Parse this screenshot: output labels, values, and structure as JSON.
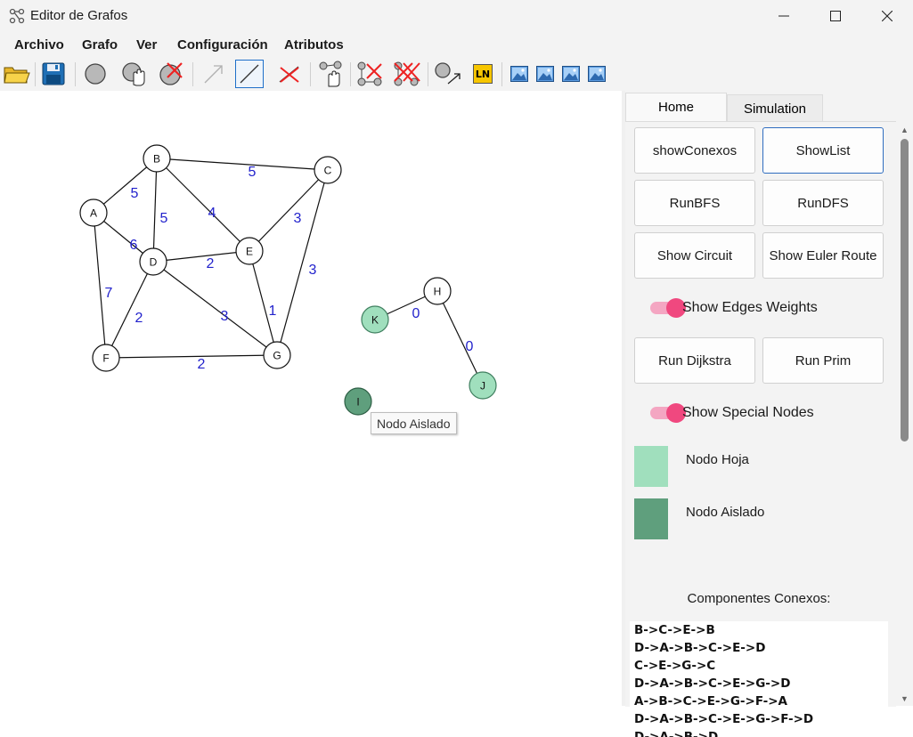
{
  "window": {
    "title": "Editor de Grafos",
    "minimize": "—",
    "maximize": "☐",
    "close": "✕"
  },
  "menu": [
    "Archivo",
    "Grafo",
    "Ver",
    "Configuración",
    "Atributos"
  ],
  "toolbar": {
    "tools": [
      "open-folder-icon",
      "save-icon",
      "add-node-icon",
      "move-node-icon",
      "delete-node-icon",
      "directed-edge-icon",
      "undirected-edge-icon",
      "delete-edge-icon",
      "move-graph-icon",
      "delete-graph-icon",
      "delete-all-icon",
      "node-arrow-icon",
      "ln-label-icon",
      "image-icon-1",
      "image-icon-2",
      "image-icon-3",
      "image-icon-4"
    ],
    "ln_label": "LN",
    "active_tool": "undirected-edge-icon"
  },
  "graph": {
    "nodes": [
      {
        "id": "A",
        "type": "normal"
      },
      {
        "id": "B",
        "type": "normal"
      },
      {
        "id": "C",
        "type": "normal"
      },
      {
        "id": "D",
        "type": "normal"
      },
      {
        "id": "E",
        "type": "normal"
      },
      {
        "id": "F",
        "type": "normal"
      },
      {
        "id": "G",
        "type": "normal"
      },
      {
        "id": "H",
        "type": "normal"
      },
      {
        "id": "K",
        "type": "leaf"
      },
      {
        "id": "J",
        "type": "leaf"
      },
      {
        "id": "I",
        "type": "isolated"
      }
    ],
    "edges": [
      {
        "from": "A",
        "to": "B",
        "weight": "5"
      },
      {
        "from": "B",
        "to": "C",
        "weight": "5"
      },
      {
        "from": "B",
        "to": "D",
        "weight": "5"
      },
      {
        "from": "B",
        "to": "E",
        "weight": "4"
      },
      {
        "from": "A",
        "to": "D",
        "weight": "6"
      },
      {
        "from": "A",
        "to": "F",
        "weight": "7"
      },
      {
        "from": "C",
        "to": "E",
        "weight": "3"
      },
      {
        "from": "C",
        "to": "G",
        "weight": "3"
      },
      {
        "from": "D",
        "to": "E",
        "weight": "2"
      },
      {
        "from": "D",
        "to": "F",
        "weight": "2"
      },
      {
        "from": "D",
        "to": "G",
        "weight": "3"
      },
      {
        "from": "E",
        "to": "G",
        "weight": "1"
      },
      {
        "from": "F",
        "to": "G",
        "weight": "2"
      },
      {
        "from": "K",
        "to": "H",
        "weight": "0"
      },
      {
        "from": "H",
        "to": "J",
        "weight": "0"
      }
    ],
    "colors": {
      "normal": "#ffffff",
      "leaf": "#a0dfbd",
      "isolated": "#5f9f7d",
      "weight": "#2222cc"
    },
    "tooltip": "Nodo Aislado"
  },
  "panel": {
    "tabs": {
      "home": "Home",
      "simulation": "Simulation"
    },
    "buttons": {
      "show_conexos": "showConexos",
      "show_list": "ShowList",
      "run_bfs": "RunBFS",
      "run_dfs": "RunDFS",
      "show_circuit": "Show Circuit",
      "show_euler": "Show Euler Route",
      "run_dijkstra": "Run Dijkstra",
      "run_prim": "Run Prim"
    },
    "toggles": {
      "edge_weights": {
        "label": "Show Edges Weights",
        "on": true
      },
      "special_nodes": {
        "label": "Show Special Nodes",
        "on": true
      }
    },
    "legend": {
      "leaf": {
        "label": "Nodo Hoja",
        "color": "#a0dfbd"
      },
      "isolated": {
        "label": "Nodo Aislado",
        "color": "#5f9f7d"
      }
    },
    "components_title": "Componentes Conexos:",
    "components": [
      "B->C->E->B",
      "D->A->B->C->E->D",
      "C->E->G->C",
      "D->A->B->C->E->G->D",
      "A->B->C->E->G->F->A",
      "D->A->B->C->E->G->F->D",
      "D->A->B->D"
    ]
  }
}
